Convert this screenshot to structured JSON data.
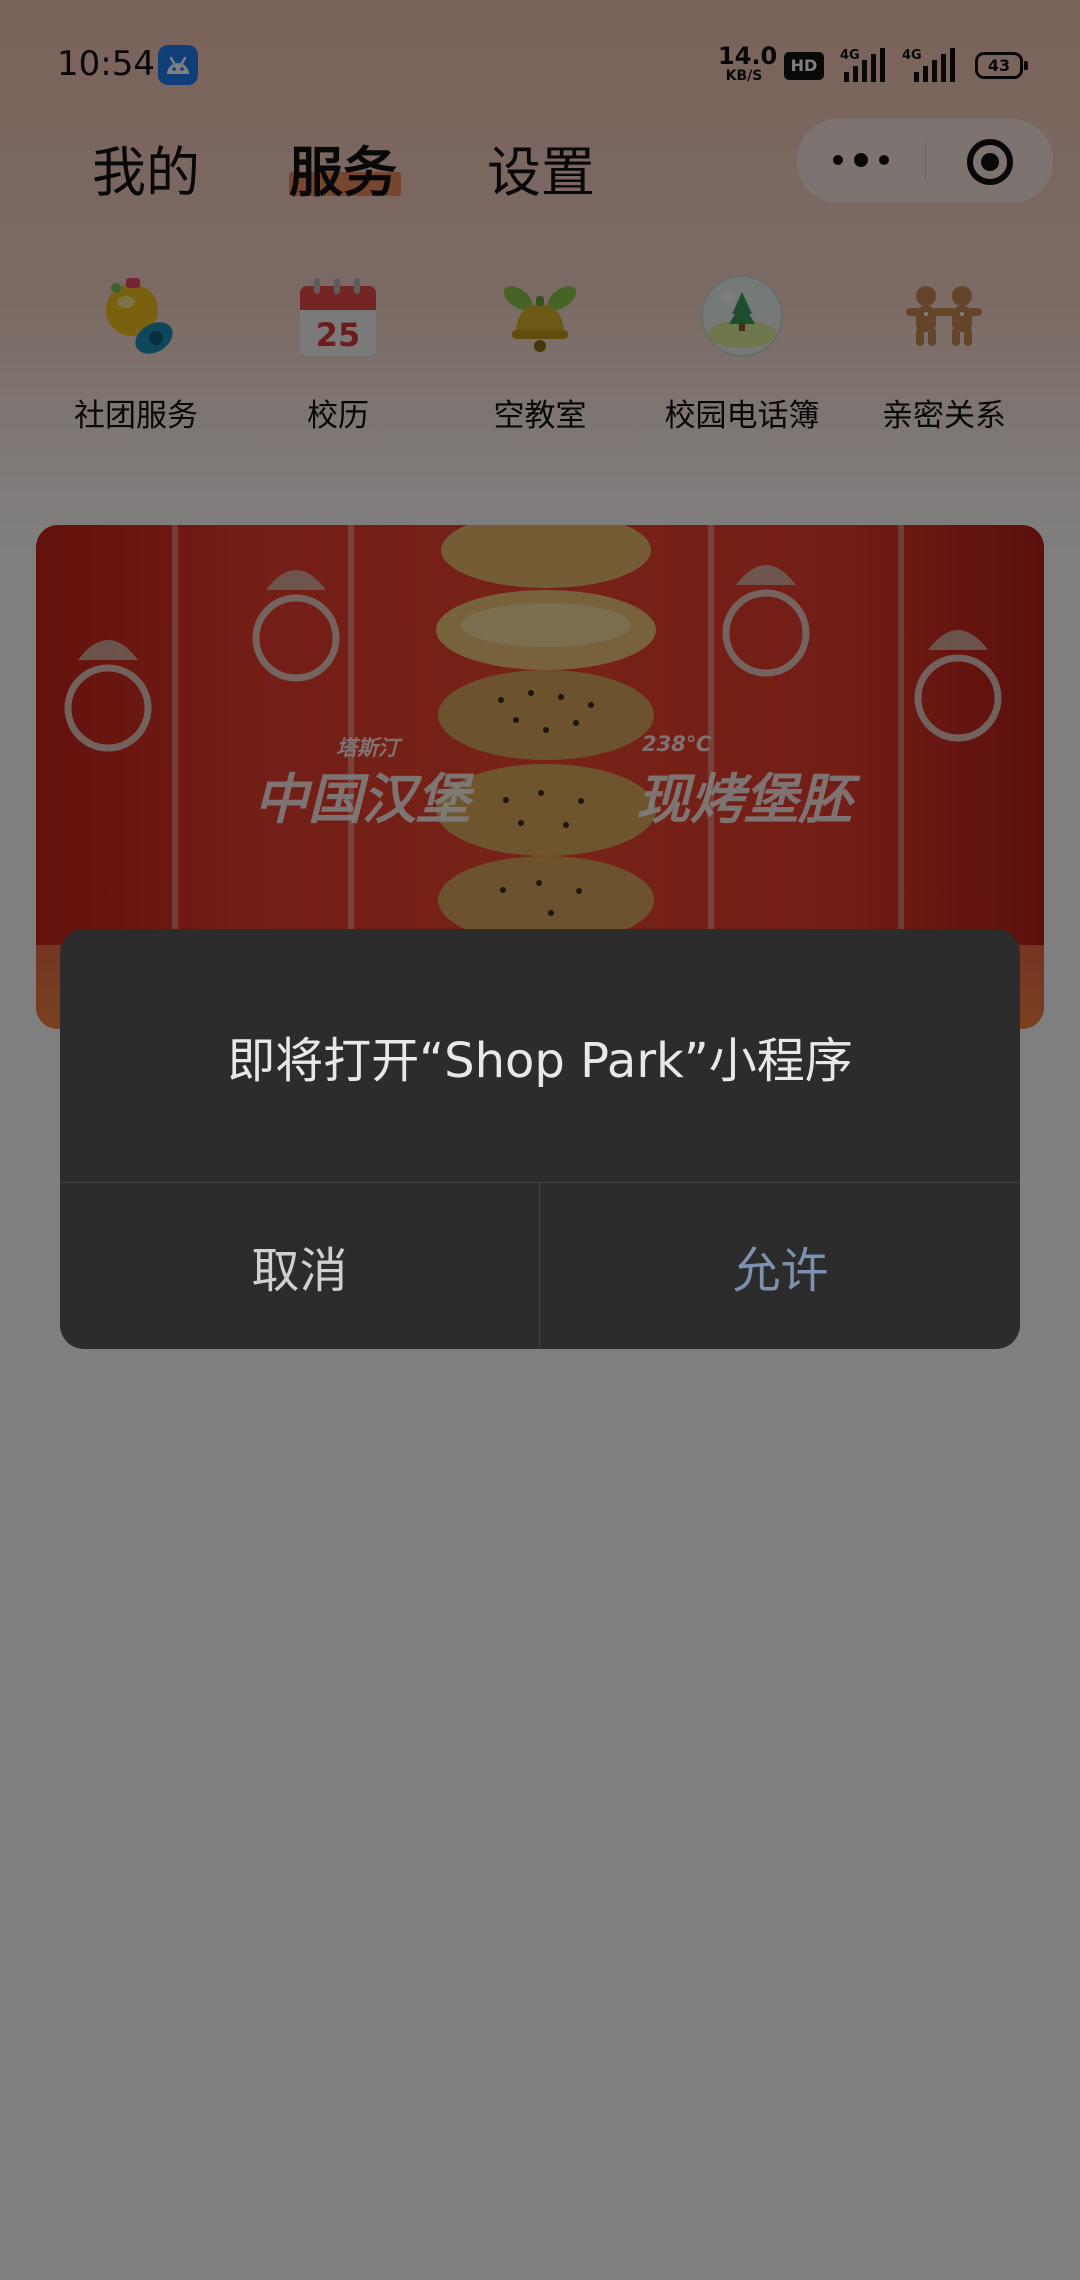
{
  "status_bar": {
    "time": "10:54",
    "net_speed_value": "14.0",
    "net_speed_unit": "KB/S",
    "hd_label": "HD",
    "network_1": "4G",
    "network_2": "4G",
    "battery": "43"
  },
  "tabs": [
    {
      "label": "我的",
      "active": false
    },
    {
      "label": "服务",
      "active": true
    },
    {
      "label": "设置",
      "active": false
    }
  ],
  "services": [
    {
      "label": "社团服务",
      "icon": "bell-pacifier-icon"
    },
    {
      "label": "校历",
      "icon": "calendar-icon",
      "icon_text": "25"
    },
    {
      "label": "空教室",
      "icon": "green-bell-icon"
    },
    {
      "label": "校园电话簿",
      "icon": "snow-globe-icon"
    },
    {
      "label": "亲密关系",
      "icon": "gingerbread-couple-icon"
    }
  ],
  "banner": {
    "left_small": "塔斯汀",
    "left_big": "中国汉堡",
    "right_small": "238℃",
    "right_big": "现烤堡胚"
  },
  "dialog": {
    "message": "即将打开“Shop Park”小程序",
    "cancel_label": "取消",
    "allow_label": "允许"
  },
  "colors": {
    "tab_underline": "#f08a62",
    "allow_button": "#7d90b0",
    "dialog_bg": "#2c2c2c",
    "app_badge": "#1f7cf3"
  }
}
